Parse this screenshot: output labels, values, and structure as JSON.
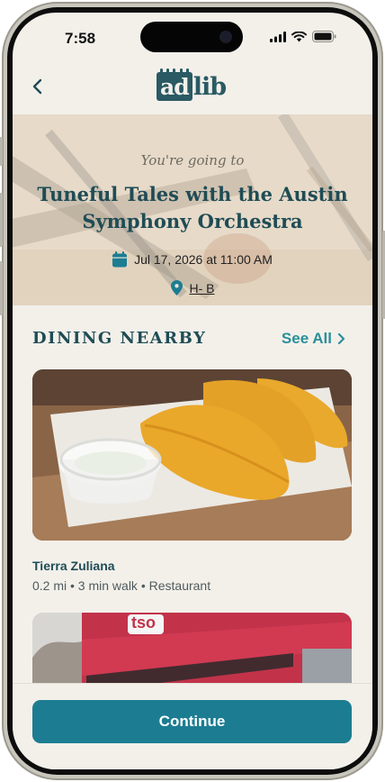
{
  "status_bar": {
    "time": "7:58"
  },
  "header": {
    "logo_part1": "ad",
    "logo_part2": "lib"
  },
  "event": {
    "kicker": "You're going to",
    "title": "Tuneful Tales with the Austin Symphony Orchestra",
    "date": "Jul 17, 2026 at 11:00 AM",
    "location": "H- B"
  },
  "dining": {
    "section_title": "DINING NEARBY",
    "see_all_label": "See All",
    "items": [
      {
        "name": "Tierra Zuliana",
        "meta": "0.2 mi • 3 min walk • Restaurant"
      },
      {
        "sign_text": "tso"
      }
    ]
  },
  "footer": {
    "continue_label": "Continue"
  },
  "colors": {
    "brand": "#2a5a63",
    "accent": "#2b8f9a",
    "button": "#1c7d92",
    "background": "#f3f0ea"
  },
  "icons": [
    "chevron-left-icon",
    "signal-icon",
    "wifi-icon",
    "battery-icon",
    "calendar-icon",
    "map-pin-icon",
    "chevron-right-icon"
  ]
}
